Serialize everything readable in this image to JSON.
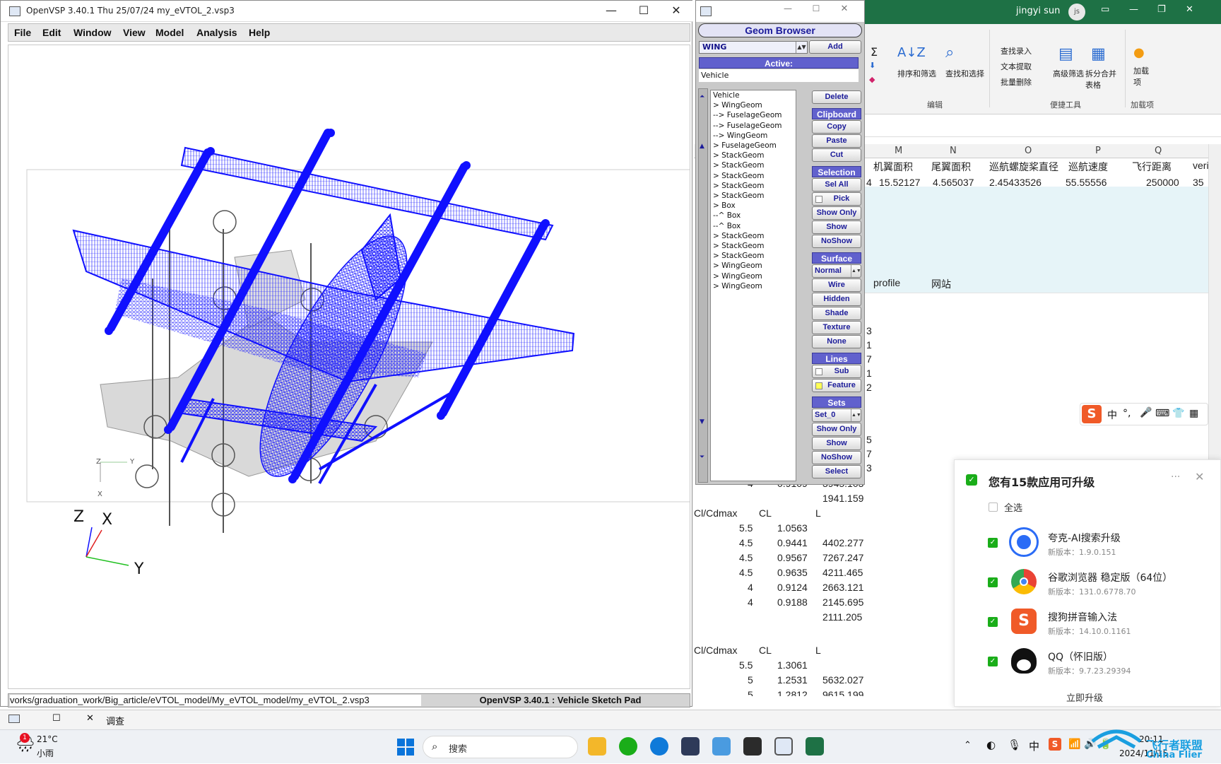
{
  "vsp_main": {
    "title": "OpenVSP 3.40.1    Thu 25/07/24    my_eVTOL_2.vsp3",
    "menu": [
      "File",
      "Edit",
      "Window",
      "View",
      "Model",
      "Analysis",
      "Help"
    ],
    "axis_small": {
      "z": "Z",
      "y": "Y",
      "x": "X"
    },
    "axis_large": {
      "z": "Z",
      "x": "X",
      "y": "Y"
    },
    "status_path": "vorks/graduation_work/Big_article/eVTOL_model/My_eVTOL_model/my_eVTOL_2.vsp3",
    "status_version": "OpenVSP 3.40.1 : Vehicle Sketch Pad"
  },
  "geom_browser": {
    "title": "Geom Browser",
    "type_select": "WING",
    "add_label": "Add",
    "active_label": "Active:",
    "active_value": "Vehicle",
    "tree": [
      "Vehicle",
      "> WingGeom",
      "--> FuselageGeom",
      "--> FuselageGeom",
      "--> WingGeom",
      "> FuselageGeom",
      "> StackGeom",
      "> StackGeom",
      "> StackGeom",
      "> StackGeom",
      "> StackGeom",
      "> Box",
      "--^ Box",
      "--^ Box",
      "> StackGeom",
      "> StackGeom",
      "> StackGeom",
      "> WingGeom",
      "> WingGeom",
      "> WingGeom"
    ],
    "delete": "Delete",
    "clipboard": "Clipboard",
    "copy": "Copy",
    "paste": "Paste",
    "cut": "Cut",
    "selection": "Selection",
    "sel_all": "Sel All",
    "pick": "Pick",
    "show_only": "Show Only",
    "show": "Show",
    "noshow": "NoShow",
    "surface": "Surface",
    "surface_mode": "Normal",
    "wire": "Wire",
    "hidden": "Hidden",
    "shade": "Shade",
    "texture": "Texture",
    "none": "None",
    "lines": "Lines",
    "sub": "Sub",
    "feature": "Feature",
    "sets": "Sets",
    "set_value": "Set_0",
    "set_show_only": "Show Only",
    "set_show": "Show",
    "set_noshow": "NoShow",
    "select": "Select"
  },
  "excel": {
    "user": "jingyi sun",
    "avatar": "js",
    "ribbon": {
      "sum": "Σ",
      "sort_filter": "排序和筛选",
      "find_select": "查找和选择",
      "group_edit": "编辑",
      "lookup_entry": "查找录入",
      "text_extract": "文本提取",
      "batch_delete": "批量删除",
      "adv_filter": "高级筛选",
      "split_merge": "拆分合并表格",
      "group_tools": "便捷工具",
      "addin": "加载项",
      "group_addin": "加载项"
    },
    "columns": [
      "M",
      "N",
      "O",
      "P",
      "Q"
    ],
    "header_row": [
      "机翼面积",
      "尾翼面积",
      "巡航螺旋桨直径",
      "巡航速度",
      "飞行距离",
      "veri"
    ],
    "data_row": [
      "4",
      "15.52127",
      "4.565037",
      "2.45433526",
      "55.55556",
      "250000",
      "35"
    ],
    "profile_labels": [
      "profile",
      "网站"
    ],
    "edge_digits": [
      "3",
      "1",
      "7",
      "1",
      "2",
      "5",
      "7",
      "3"
    ],
    "table1": {
      "pre_rows": [
        [
          "4",
          "0.9109",
          "3945.103"
        ],
        [
          "",
          "",
          "1941.159"
        ]
      ],
      "header": [
        "Cl/Cdmax",
        "CL",
        "L"
      ],
      "rows": [
        [
          "5.5",
          "1.0563",
          ""
        ],
        [
          "4.5",
          "0.9441",
          "4402.277"
        ],
        [
          "4.5",
          "0.9567",
          "7267.247"
        ],
        [
          "4.5",
          "0.9635",
          "4211.465"
        ],
        [
          "4",
          "0.9124",
          "2663.121"
        ],
        [
          "4",
          "0.9188",
          "2145.695"
        ],
        [
          "",
          "",
          "2111.205"
        ]
      ]
    },
    "table2": {
      "header": [
        "Cl/Cdmax",
        "CL",
        "L"
      ],
      "rows": [
        [
          "5.5",
          "1.3061",
          ""
        ],
        [
          "5",
          "1.2531",
          "5632.027"
        ],
        [
          "5",
          "1.2812",
          "9615.199"
        ]
      ]
    },
    "sheet_tab": "调查"
  },
  "notification": {
    "title": "您有15款应用可升级",
    "select_all": "全选",
    "items": [
      {
        "name": "夸克-AI搜索升级",
        "version": "新版本：1.9.0.151"
      },
      {
        "name": "谷歌浏览器 稳定版（64位）",
        "version": "新版本：131.0.6778.70"
      },
      {
        "name": "搜狗拼音输入法",
        "version": "新版本：14.10.0.1161"
      },
      {
        "name": "QQ（怀旧版）",
        "version": "新版本：9.7.23.29394"
      }
    ],
    "upgrade_btn": "立即升级"
  },
  "ime_bar": {
    "logo": "S",
    "mode": "中"
  },
  "taskbar": {
    "weather_temp": "21°C",
    "weather_desc": "小雨",
    "weather_badge": "1",
    "search_placeholder": "搜索",
    "ime": "中",
    "clock_time": "20:11",
    "clock_date": "2024/11/15",
    "watermark": "飞行者联盟",
    "watermark_sub": "China Flier"
  },
  "colors": {
    "model_blue": "#1010ff",
    "excel_green": "#1e7145",
    "button_header": "#6161cd"
  }
}
